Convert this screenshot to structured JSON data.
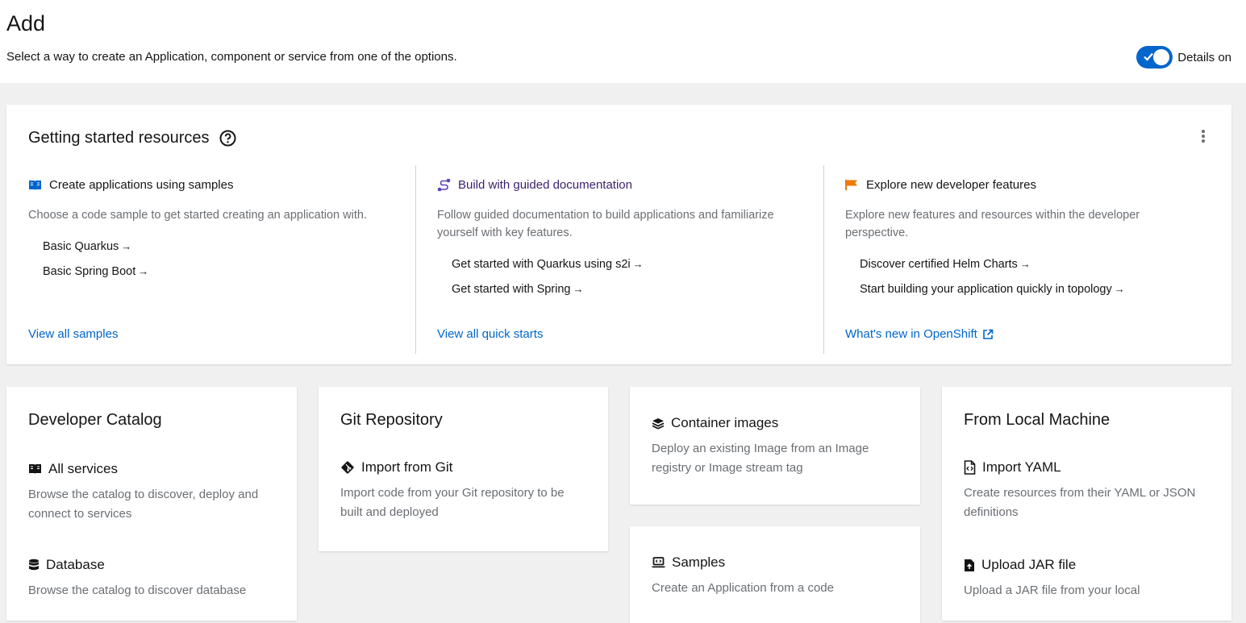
{
  "header": {
    "title": "Add",
    "subtitle": "Select a way to create an Application, component or service from one of the options.",
    "details_toggle": {
      "label": "Details on",
      "on": true,
      "color": "#0066cc"
    }
  },
  "getting_started": {
    "title": "Getting started resources",
    "help_icon": "question-circle-icon",
    "menu_icon": "kebab-icon",
    "columns": [
      {
        "icon": "book-icon",
        "title": "Create applications using samples",
        "description": "Choose a code sample to get started creating an application with.",
        "links": [
          "Basic Quarkus",
          "Basic Spring Boot"
        ],
        "footer": "View all samples"
      },
      {
        "icon": "route-icon",
        "title": "Build with guided documentation",
        "description": "Follow guided documentation to build applications and familiarize yourself with key features.",
        "links": [
          "Get started with Quarkus using s2i",
          "Get started with Spring"
        ],
        "footer": "View all quick starts"
      },
      {
        "icon": "flag-icon",
        "title": "Explore new developer features",
        "description": "Explore new features and resources within the developer perspective.",
        "links": [
          "Discover certified Helm Charts",
          "Start building your application quickly in topology"
        ],
        "footer": "What's new in OpenShift"
      }
    ]
  },
  "tiles": {
    "developer_catalog": {
      "title": "Developer Catalog",
      "items": [
        {
          "icon": "book-open-icon",
          "label": "All services",
          "description": "Browse the catalog to discover, deploy and connect to services"
        },
        {
          "icon": "database-icon",
          "label": "Database",
          "description": "Browse the catalog to discover database"
        }
      ]
    },
    "git_repository": {
      "title": "Git Repository",
      "items": [
        {
          "icon": "git-icon",
          "label": "Import from Git",
          "description": "Import code from your Git repository to be built and deployed"
        }
      ]
    },
    "container_images": {
      "icon": "layers-icon",
      "label": "Container images",
      "description": "Deploy an existing Image from an Image registry or Image stream tag"
    },
    "samples": {
      "icon": "laptop-code-icon",
      "label": "Samples",
      "description": "Create an Application from a code"
    },
    "local_machine": {
      "title": "From Local Machine",
      "items": [
        {
          "icon": "file-code-icon",
          "label": "Import YAML",
          "description": "Create resources from their YAML or JSON definitions"
        },
        {
          "icon": "file-upload-icon",
          "label": "Upload JAR file",
          "description": "Upload a JAR file from your local"
        }
      ]
    }
  },
  "colors": {
    "link": "#0066cc",
    "accent_flag": "#ec7a08",
    "route_purple": "#5e40be"
  }
}
